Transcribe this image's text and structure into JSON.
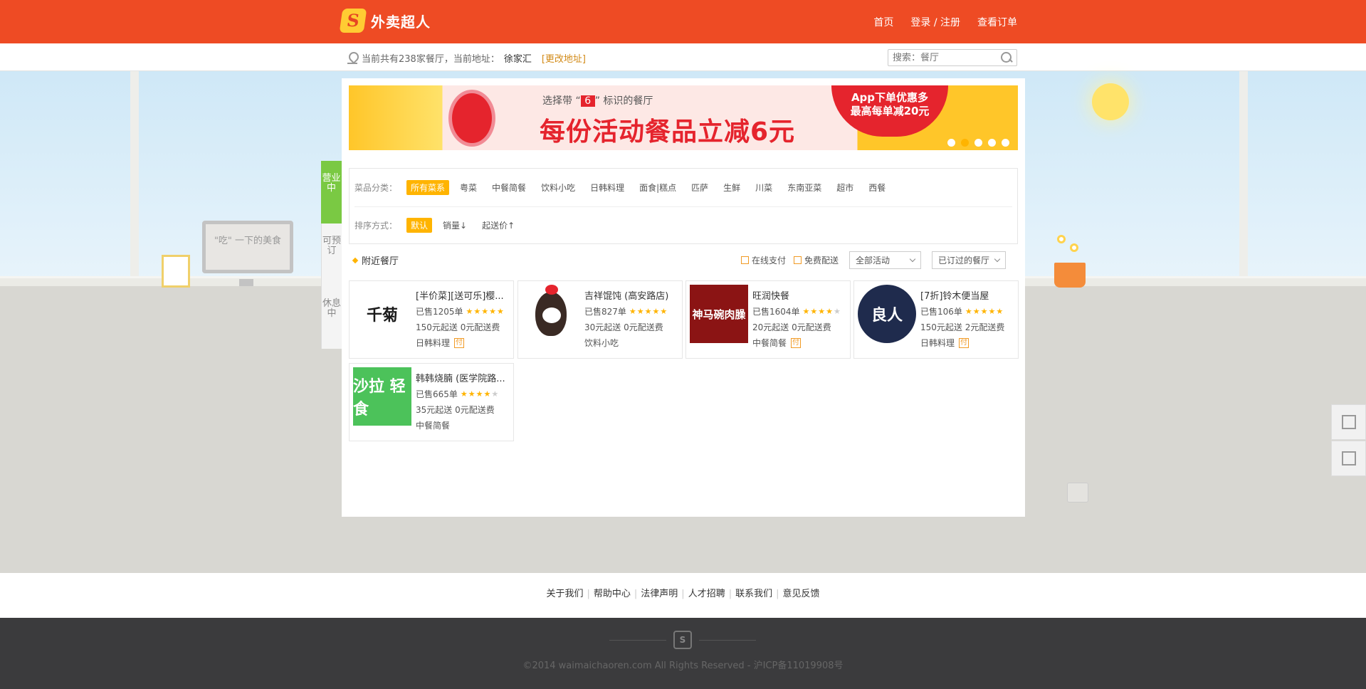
{
  "header": {
    "logo_char": "S",
    "brand": "外卖超人",
    "nav": [
      "首页",
      "登录 / 注册",
      "查看订单"
    ]
  },
  "info_bar": {
    "summary": "当前共有238家餐厅，当前地址：",
    "address": "徐家汇",
    "change_address": "[更改地址]",
    "search_placeholder": "搜索：餐厅"
  },
  "scene": {
    "monitor_text": "\"吃\" 一下的美食"
  },
  "banner": {
    "sub_prefix": "选择带 “",
    "sub_mark": "6",
    "sub_suffix": "” 标识的餐厅",
    "headline": "每份活动餐品立减6元",
    "bubble_line1": "App下单优惠多",
    "bubble_line2": "最高每单减20元",
    "slide_count": 5,
    "active_slide": 1
  },
  "status_tabs": [
    "营业中",
    "可预订",
    "休息中"
  ],
  "filters": {
    "category_label": "菜品分类：",
    "categories": [
      "所有菜系",
      "粤菜",
      "中餐简餐",
      "饮料小吃",
      "日韩料理",
      "面食|糕点",
      "匹萨",
      "生鲜",
      "川菜",
      "东南亚菜",
      "超市",
      "西餐"
    ],
    "selected_category": "所有菜系",
    "sort_label": "排序方式：",
    "sorts": [
      "默认",
      "销量↓",
      "起送价↑"
    ],
    "selected_sort": "默认"
  },
  "list": {
    "title": "附近餐厅",
    "online_pay": "在线支付",
    "free_delivery": "免费配送",
    "activity_select": "全部活动",
    "ordered_select": "已订过的餐厅"
  },
  "restaurants": [
    {
      "name": "[半价菜][送可乐]樱...",
      "sold": "已售1205单",
      "rating": 5,
      "min_order": "150元起送",
      "fee": "0元配送费",
      "cuisine": "日韩料理",
      "pay_badge": "付",
      "thumb_text": "千菊",
      "thumb_bg": "#ffffff",
      "thumb_fg": "#1a1a1a"
    },
    {
      "name": "吉祥馄饨 (高安路店)",
      "sold": "已售827单",
      "rating": 5,
      "min_order": "30元起送",
      "fee": "0元配送费",
      "cuisine": "饮料小吃",
      "pay_badge": "",
      "thumb_text": "",
      "thumb_bg": "#ffffff",
      "thumb_fg": "#c62828"
    },
    {
      "name": "旺润快餐",
      "sold": "已售1604单",
      "rating": 4,
      "min_order": "20元起送",
      "fee": "0元配送费",
      "cuisine": "中餐简餐",
      "pay_badge": "付",
      "thumb_text": "神马碗肉臊",
      "thumb_bg": "#8b1414",
      "thumb_fg": "#ffffff"
    },
    {
      "name": "[7折]铃木便当屋",
      "sold": "已售106单",
      "rating": 5,
      "min_order": "150元起送",
      "fee": "2元配送费",
      "cuisine": "日韩料理",
      "pay_badge": "付",
      "thumb_text": "良人",
      "thumb_bg": "#1f2b4d",
      "thumb_fg": "#ffffff"
    },
    {
      "name": "韩韩烧腩 (医学院路...",
      "sold": "已售665单",
      "rating": 4,
      "min_order": "35元起送",
      "fee": "0元配送费",
      "cuisine": "中餐简餐",
      "pay_badge": "",
      "thumb_text": "沙拉 轻食",
      "thumb_bg": "#4cc25a",
      "thumb_fg": "#ffffff"
    }
  ],
  "footer": {
    "links": [
      "关于我们",
      "帮助中心",
      "法律声明",
      "人才招聘",
      "联系我们",
      "意见反馈"
    ],
    "logo_char": "S",
    "copyright": "©2014 waimaichaoren.com All Rights Reserved - 沪ICP备11019908号"
  },
  "colors": {
    "brand": "#ee4b24",
    "accent": "#ffb400",
    "open_tab": "#7ac943"
  }
}
